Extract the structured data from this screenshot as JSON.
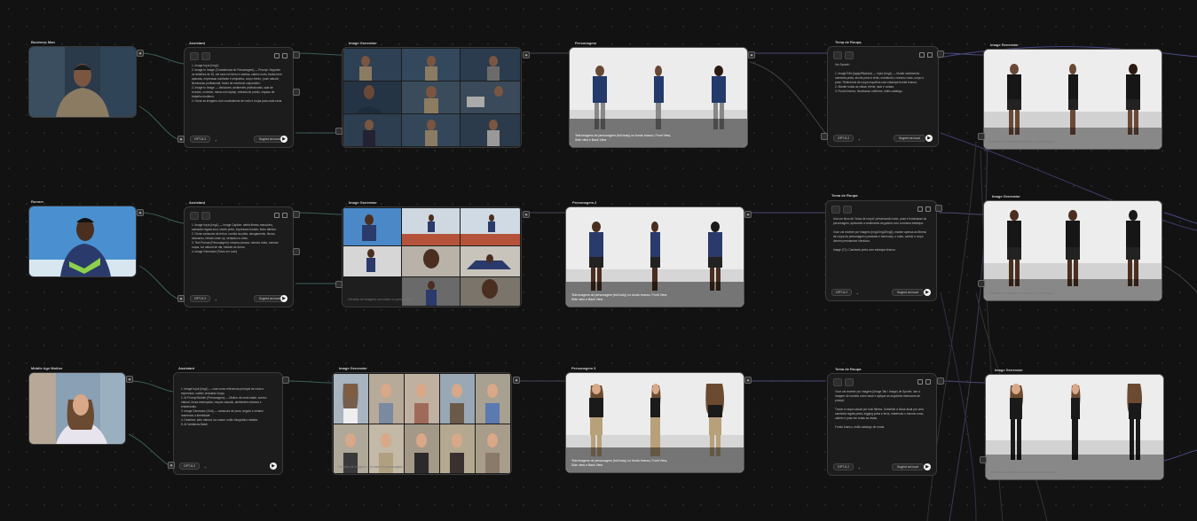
{
  "rows": [
    {
      "source": {
        "title": "Business Man"
      },
      "assistant": {
        "title": "Assistant",
        "model": "GPT-5.2",
        "generate_label": "Sugest as local",
        "text": "1. Image Input (Img1)\n2. Image to Image (Consistencia do Personagem) — Prompt: Segundo os detalhes de 30, ele sera em terno e camisa, cabelo curto, barba bem aparada, expressao confiante e simpatica, corpo inteiro, pose natural, iluminacao profissional, fundo de escritorio corporativo.\n3. Image to Image — Variacoes: ambientes profissionais, sala de reuniao, corredor, mesa com laptop, entrada de predio, espaco de trabalho moderno.\n4. Gerar as imagens com consistencia de rosto e roupa para cada cena."
      },
      "grid": {
        "title": "Image Generator",
        "count": 12,
        "caption": "Image Generator"
      },
      "char": {
        "title": "Personagem",
        "caption": "Tela imagens do personagem (full body) no fundo branco, Front View, Side view e Back View"
      },
      "tema": {
        "title": "Tema de Roupa",
        "model": "GPT-5.2",
        "generate_label": "Sugest as local",
        "text": "Ver Sponte:\n\n1. Image Edit (Apply/Replace) — input (Img1) — Mudar vestimenta: camiseta preta, shorts preto e tenis, mantendo o mesmo rosto, corpo e pose. Referencia de roupa esportiva com estampa frontal branca.\n2. Manter todas as vistas: frente, lado e costas.\n3. Fundo branco, iluminacao uniforme, estilo catalogo."
      },
      "final": {
        "title": "Image Generator",
        "caption": "Gerador de imagens com base no personagem..."
      }
    },
    {
      "source": {
        "title": "Runner"
      },
      "assistant": {
        "title": "Assistant",
        "model": "GPT-5.2",
        "generate_label": "Sugest as local",
        "text": "1. Image Input (Img1) — Image Caption: atleta fitness masculino, camiseta regata azul, shorts preto, expressao focada, fisico atletico.\n2. Gerar variacoes de treino: corrida na pista, alongamento, flexao, descanso, retrato close-up, sentado no chao.\n3. Text Prompt (Personagem): mesma pessoa, mesmo rosto, mesma roupa, luz natural de dia, estadio ao fundo.\n4. Image Generator (Fotos em Lote)"
      },
      "grid": {
        "title": "Image Generator",
        "count": 10,
        "caption": "Gerador de imagens com base no personagem..."
      },
      "char": {
        "title": "Personagem 2",
        "caption": "Tela imagens do personagem (full body) no fundo branco, Front View, Side view e Back View"
      },
      "tema": {
        "title": "Tema de Roupa",
        "model": "GPT-5.2",
        "generate_label": "Sugest as local",
        "text": "Use um fluxo de \"troca de roupa\" preservando rosto, pose e iluminacao do personagem, aplicando a vestimenta da galeria com a mesma estampa.\n\nVoce vai receber por imagem (Img1/Img2/Img3), manter apenas as fitness de roupa do personagem (camiseta e bermuda), o rosto, cabelo e corpo devem permanecer identicos.\n\nImage (T1): Camiseta preta com estampa branca."
      },
      "final": {
        "title": "Image Generator",
        "caption": "Gerador de imagens com base no personagem..."
      }
    },
    {
      "source": {
        "title": "Middle Age Mother"
      },
      "assistant": {
        "title": "Assistant",
        "model": "GPT-5.2",
        "generate_label": "",
        "text": "1. Image Input (Img1) — usar como referencia principal de rosto e expressao, cabelo ondulado longo.\n2. AI Prompt Builder (Personagem) — Mulher de meia idade, sorriso natural, blusa estampada, roupas casuais, ambientes urbanos e residenciais.\n3. Image Generator (Grid) — variacoes de pose, angulo e cenario mantendo a identidade.\n4. Detalhes: pele natural, luz suave, estilo fotografico realista.\n5. AI Variations Batch"
      },
      "grid": {
        "title": "Image Generator",
        "count": 10,
        "caption": "Gerador de imagens com base no personagem..."
      },
      "char": {
        "title": "Personagem 3",
        "caption": "Tela imagens do personagem (full body) no fundo branco, Front View, Side view e Back View"
      },
      "tema": {
        "title": "Tema de Roupa",
        "model": "GPT-5.2",
        "generate_label": "Sugest as local",
        "text": "Voce vai receber por imagem (Image Tab / Image) de Sponte, use a imagem de modelo como base e aplique as seguintes instrucoes de prompt:\n\nTrocar a roupa casual por look fitness. Substituir a blusa atual por uma camiseta regata preta, legging preta e tenis, mantendo o mesmo rosto, cabelo e pose em todas as vistas.\n\nFundo branco, estilo catalogo de moda."
      },
      "final": {
        "title": "Image Generator",
        "caption": "Gerador de imagens com base no personagem..."
      }
    }
  ]
}
